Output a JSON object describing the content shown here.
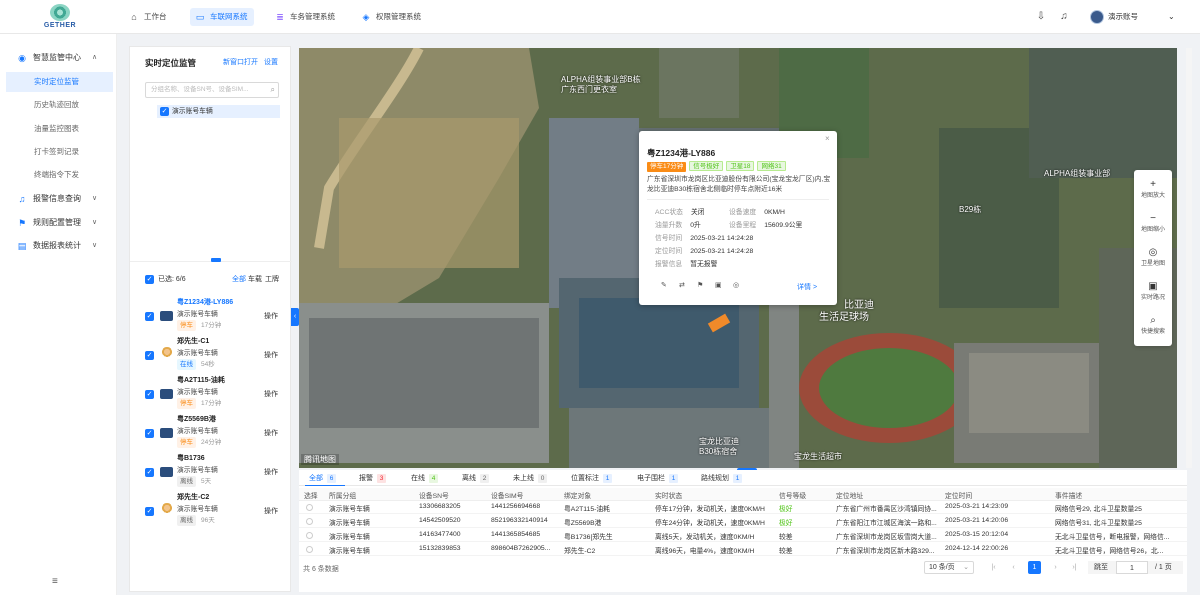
{
  "app": {
    "logo_text": "GETHER"
  },
  "nav": {
    "tabs": [
      {
        "label": "工作台"
      },
      {
        "label": "车联网系统"
      },
      {
        "label": "车务管理系统"
      },
      {
        "label": "权限管理系统"
      }
    ],
    "active": 1
  },
  "user": {
    "name": "演示账号",
    "chevron": "⌄"
  },
  "sidebar": {
    "groups": [
      {
        "label": "智慧监管中心",
        "icon": "monitor-icon",
        "expanded": true,
        "items": [
          {
            "label": "实时定位监管"
          },
          {
            "label": "历史轨迹回放"
          },
          {
            "label": "油量监控图表"
          },
          {
            "label": "打卡签到记录"
          },
          {
            "label": "终端指令下发"
          }
        ]
      },
      {
        "label": "报警信息查询",
        "icon": "bell-icon"
      },
      {
        "label": "规则配置管理",
        "icon": "flag-icon"
      },
      {
        "label": "数据报表统计",
        "icon": "report-icon"
      }
    ],
    "menu_toggle": "≡"
  },
  "panel": {
    "title": "实时定位监管",
    "open_new": "新窗口打开",
    "settings": "设置",
    "search_placeholder": "分组名称、设备SN号、设备SIM...",
    "tree_node": "演示账号车辆",
    "selected_label": "已选: 6/6",
    "filters": [
      "全部",
      "车载",
      "工牌"
    ],
    "vehicles": [
      {
        "name": "粤Z1234港-LY886",
        "group": "演示账号车辆",
        "status": "停车",
        "status_type": "stop",
        "duration": "17分钟",
        "op": "操作",
        "kind": "car",
        "highlight": true
      },
      {
        "name": "郑先生-C1",
        "group": "演示账号车辆",
        "status": "在线",
        "status_type": "online",
        "duration": "54秒",
        "op": "操作",
        "kind": "person"
      },
      {
        "name": "粤A2T115-油耗",
        "group": "演示账号车辆",
        "status": "停车",
        "status_type": "stop",
        "duration": "17分钟",
        "op": "操作",
        "kind": "car"
      },
      {
        "name": "粤Z5569B港",
        "group": "演示账号车辆",
        "status": "停车",
        "status_type": "stop",
        "duration": "24分钟",
        "op": "操作",
        "kind": "car"
      },
      {
        "name": "粤B1736",
        "group": "演示账号车辆",
        "status": "离线",
        "status_type": "off",
        "duration": "5天",
        "op": "操作",
        "kind": "car"
      },
      {
        "name": "郑先生-C2",
        "group": "演示账号车辆",
        "status": "离线",
        "status_type": "off",
        "duration": "96天",
        "op": "操作",
        "kind": "person"
      }
    ]
  },
  "map": {
    "labels": [
      "ALPHA组装事业部B栋",
      "广东西门更衣室",
      "B29栋",
      "ALPHA组装事业部",
      "比亚迪",
      "生活足球场",
      "宝龙比亚迪",
      "B30栋宿舍",
      "宝龙生活超市"
    ],
    "logo": "腾讯地图",
    "tools": [
      {
        "label": "地图放大",
        "icon": "plus-icon",
        "glyph": "+"
      },
      {
        "label": "地图缩小",
        "icon": "minus-icon",
        "glyph": "−"
      },
      {
        "label": "卫星地图",
        "icon": "satellite-icon",
        "glyph": "◎"
      },
      {
        "label": "实时路况",
        "icon": "traffic-icon",
        "glyph": "▣"
      },
      {
        "label": "快捷搜索",
        "icon": "search-icon",
        "glyph": "⌕"
      }
    ]
  },
  "popup": {
    "title": "粤Z1234港-LY886",
    "tags": [
      {
        "text": "停车17分钟",
        "type": "o"
      },
      {
        "text": "信号极好",
        "type": "g"
      },
      {
        "text": "卫星18",
        "type": "g"
      },
      {
        "text": "网络31",
        "type": "g"
      }
    ],
    "address": "广东省深圳市龙岗区比亚迪股份有限公司(宝龙宝龙厂区)内,宝龙比亚迪B30栋宿舍北侧临时停车点附近16米",
    "info": [
      {
        "k": "ACC状态",
        "v": "关闭",
        "k2": "设备速度",
        "v2": "0KM/H"
      },
      {
        "k": "油量升数",
        "v": "0升",
        "k2": "设备里程",
        "v2": "15609.9公里"
      },
      {
        "k": "信号时间",
        "v": "2025-03-21 14:24:28"
      },
      {
        "k": "定位时间",
        "v": "2025-03-21 14:24:28"
      },
      {
        "k": "报警信息",
        "v": "暂无报警"
      }
    ],
    "detail": "详情 >",
    "close": "×"
  },
  "bottom": {
    "tabs": [
      {
        "label": "全部",
        "count": "6",
        "style": "blue"
      },
      {
        "label": "报警",
        "count": "3",
        "style": "red"
      },
      {
        "label": "在线",
        "count": "4",
        "style": "grn"
      },
      {
        "label": "离线",
        "count": "2",
        "style": "gry"
      },
      {
        "label": "未上线",
        "count": "0",
        "style": "gry"
      },
      {
        "label": "位置标注",
        "count": "1",
        "style": "blue"
      },
      {
        "label": "电子围栏",
        "count": "1",
        "style": "blue"
      },
      {
        "label": "路线规划",
        "count": "1",
        "style": "blue"
      }
    ],
    "columns": [
      "选择",
      "所属分组",
      "设备SN号",
      "设备SIM号",
      "绑定对象",
      "实时状态",
      "信号等级",
      "定位地址",
      "定位时间",
      "事件描述"
    ],
    "rows": [
      [
        "演示账号车辆",
        "13306683205",
        "1441256694668",
        "粤A2T115-油耗",
        "停车17分钟，发动机关，速度0KM/H",
        "极好",
        "广东省广州市番禺区沙湾镇同协...",
        "2025-03-21 14:23:09",
        "网络信号29, 北斗卫星数量25"
      ],
      [
        "演示账号车辆",
        "14542509520",
        "852196332140914",
        "粤Z5569B港",
        "停车24分钟，发动机关，速度0KM/H",
        "极好",
        "广东省阳江市江城区海滨一路和...",
        "2025-03-21 14:20:06",
        "网络信号31, 北斗卫星数量25"
      ],
      [
        "演示账号车辆",
        "14163477400",
        "1441365854685",
        "粤B1736[郑先生",
        "离线5天，发动机关，速度0KM/H",
        "较差",
        "广东省深圳市龙岗区坂雪岗大道...",
        "2025-03-15 20:12:04",
        "无北斗卫星信号，断电报警，网络信..."
      ],
      [
        "演示账号车辆",
        "15132839853",
        "898604B7262905...",
        "郑先生-C2",
        "离线96天，电量4%，速度0KM/H",
        "较差",
        "广东省深圳市龙岗区新木路329...",
        "2024-12-14 22:00:26",
        "无北斗卫星信号，网络信号26，北..."
      ]
    ],
    "total": "共 6 条数据",
    "page_size": "10 条/页",
    "page_current": "1",
    "jump_label": "跳至",
    "jump_value": "1",
    "page_total": "/ 1 页"
  }
}
